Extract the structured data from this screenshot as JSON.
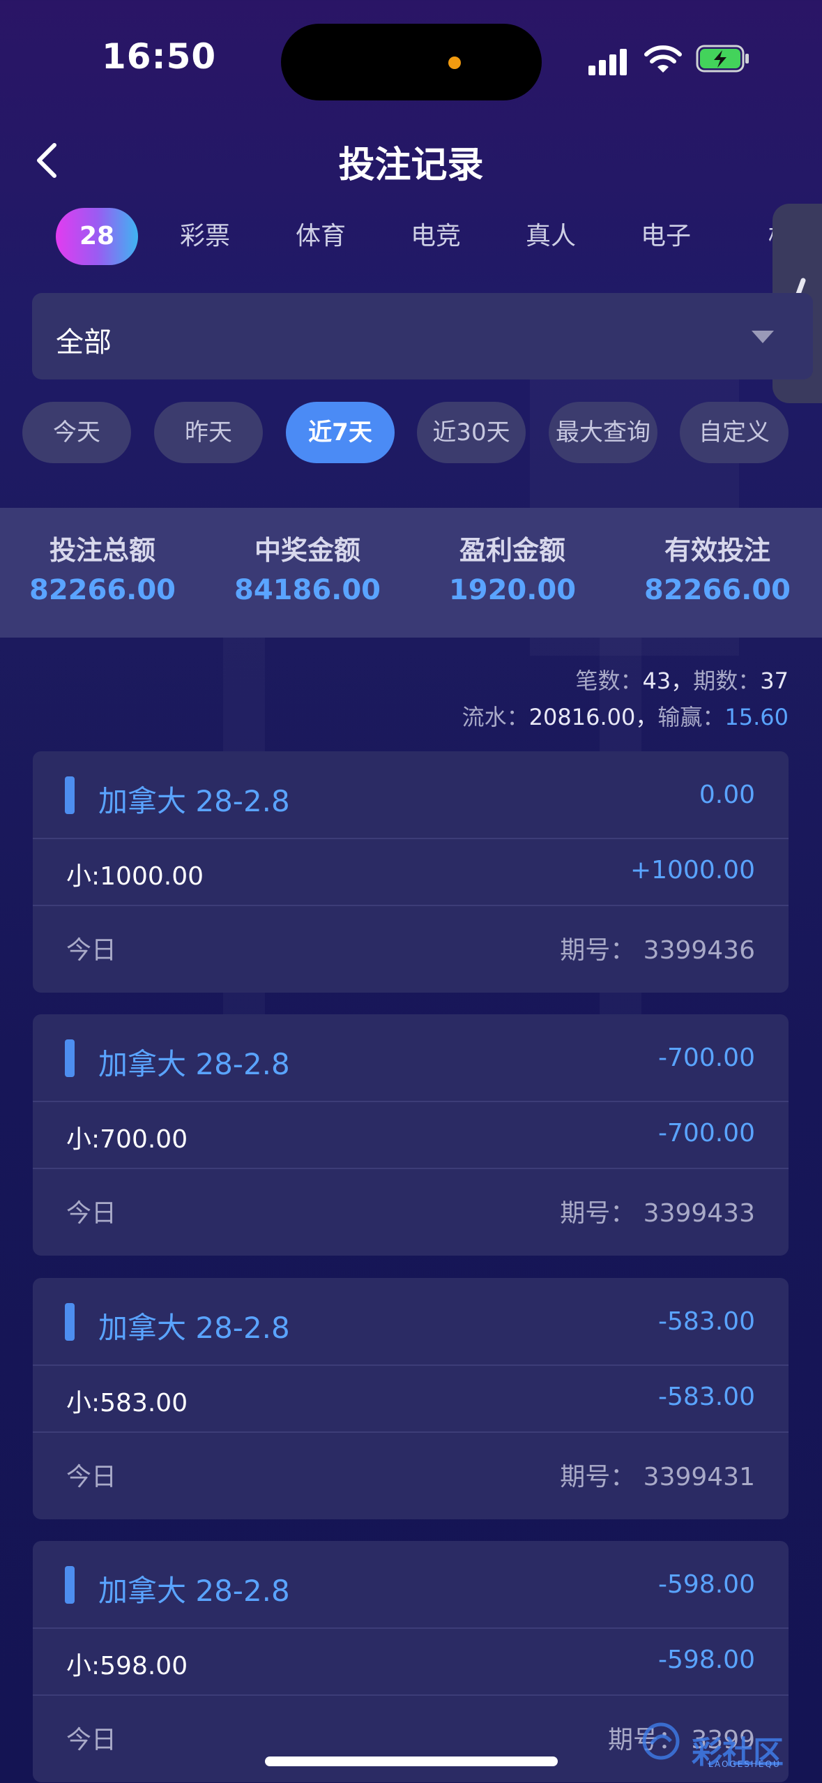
{
  "status_bar": {
    "time": "16:50"
  },
  "header": {
    "title": "投注记录"
  },
  "category_tabs": [
    {
      "label": "28",
      "active": true
    },
    {
      "label": "彩票"
    },
    {
      "label": "体育"
    },
    {
      "label": "电竞"
    },
    {
      "label": "真人"
    },
    {
      "label": "电子"
    },
    {
      "label": "棋"
    }
  ],
  "filter": {
    "selected": "全部"
  },
  "date_ranges": [
    {
      "label": "今天"
    },
    {
      "label": "昨天"
    },
    {
      "label": "近7天",
      "active": true
    },
    {
      "label": "近30天"
    },
    {
      "label": "最大查询"
    },
    {
      "label": "自定义"
    }
  ],
  "summary": [
    {
      "label": "投注总额",
      "value": "82266.00"
    },
    {
      "label": "中奖金额",
      "value": "84186.00"
    },
    {
      "label": "盈利金额",
      "value": "1920.00"
    },
    {
      "label": "有效投注",
      "value": "82266.00"
    }
  ],
  "stats": {
    "count_label": "笔数：",
    "count": "43",
    "periods_label": "期数：",
    "periods": "37",
    "flow_label": "流水：",
    "flow": "20816.00",
    "winloss_label": "输赢：",
    "winloss": "15.60",
    "sep": "，"
  },
  "records": [
    {
      "game": "加拿大 28-2.8",
      "amount": "0.00",
      "bet": "小:1000.00",
      "result": "+1000.00",
      "date": "今日",
      "issue": "期号：  3399436"
    },
    {
      "game": "加拿大 28-2.8",
      "amount": "-700.00",
      "bet": "小:700.00",
      "result": "-700.00",
      "date": "今日",
      "issue": "期号：  3399433"
    },
    {
      "game": "加拿大 28-2.8",
      "amount": "-583.00",
      "bet": "小:583.00",
      "result": "-583.00",
      "date": "今日",
      "issue": "期号：  3399431"
    },
    {
      "game": "加拿大 28-2.8",
      "amount": "-598.00",
      "bet": "小:598.00",
      "result": "-598.00",
      "date": "今日",
      "issue": "期号：  3399"
    }
  ],
  "watermark": {
    "text": "彩社区",
    "sub": "LAOGESHEQU"
  },
  "colors": {
    "accent": "#4b8bf5",
    "value_blue": "#5aa4ff",
    "card": "#2b2b64"
  }
}
